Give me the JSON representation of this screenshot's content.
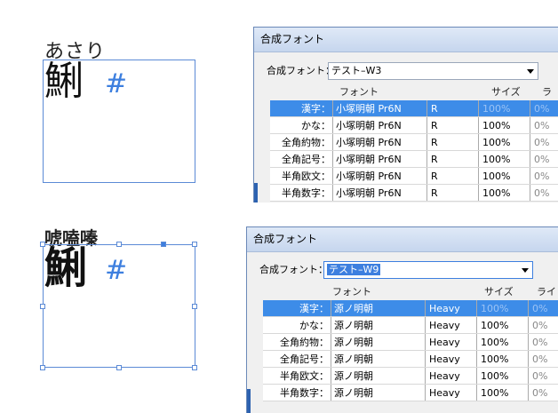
{
  "samples": [
    {
      "ruby": "あさり",
      "kanji": "鯏",
      "mark": "#"
    },
    {
      "ruby": "唬嗑嗪",
      "kanji": "鯏",
      "mark": "#"
    }
  ],
  "dialogs": [
    {
      "title": "合成フォント",
      "set_label": "合成フォント：",
      "set_value": "テスト–W3",
      "headers": {
        "font": "フォント",
        "size": "サイズ",
        "line": "ライン"
      },
      "rows": [
        {
          "label": "漢字：",
          "font": "小塚明朝 Pr6N",
          "weight": "R",
          "size": "100%",
          "line": "0%"
        },
        {
          "label": "かな：",
          "font": "小塚明朝 Pr6N",
          "weight": "R",
          "size": "100%",
          "line": "0%"
        },
        {
          "label": "全角約物：",
          "font": "小塚明朝 Pr6N",
          "weight": "R",
          "size": "100%",
          "line": "0%"
        },
        {
          "label": "全角記号：",
          "font": "小塚明朝 Pr6N",
          "weight": "R",
          "size": "100%",
          "line": "0%"
        },
        {
          "label": "半角欧文：",
          "font": "小塚明朝 Pr6N",
          "weight": "R",
          "size": "100%",
          "line": "0%"
        },
        {
          "label": "半角数字：",
          "font": "小塚明朝 Pr6N",
          "weight": "R",
          "size": "100%",
          "line": "0%"
        }
      ]
    },
    {
      "title": "合成フォント",
      "set_label": "合成フォント：",
      "set_value": "テスト–W9",
      "headers": {
        "font": "フォント",
        "size": "サイズ",
        "line": "ライン"
      },
      "rows": [
        {
          "label": "漢字：",
          "font": "源ノ明朝",
          "weight": "Heavy",
          "size": "100%",
          "line": "0%"
        },
        {
          "label": "かな：",
          "font": "源ノ明朝",
          "weight": "Heavy",
          "size": "100%",
          "line": "0%"
        },
        {
          "label": "全角約物：",
          "font": "源ノ明朝",
          "weight": "Heavy",
          "size": "100%",
          "line": "0%"
        },
        {
          "label": "全角記号：",
          "font": "源ノ明朝",
          "weight": "Heavy",
          "size": "100%",
          "line": "0%"
        },
        {
          "label": "半角欧文：",
          "font": "源ノ明朝",
          "weight": "Heavy",
          "size": "100%",
          "line": "0%"
        },
        {
          "label": "半角数字：",
          "font": "源ノ明朝",
          "weight": "Heavy",
          "size": "100%",
          "line": "0%"
        }
      ]
    }
  ],
  "colors": {
    "accent": "#3d8ce8",
    "frame": "#5b8ad6"
  }
}
